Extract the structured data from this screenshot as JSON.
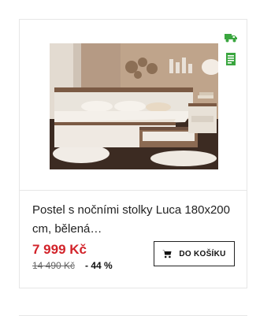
{
  "product": {
    "name": "Postel s nočními stolky Luca 180x200 cm, bělená…",
    "price": "7 999 Kč",
    "old_price": "14 490 Kč",
    "discount": "- 44 %",
    "cart_button_label": "DO KOŠÍKU",
    "badges": [
      "truck-icon",
      "document-icon"
    ],
    "accent_color": "#d2232a",
    "badge_color": "#3aa63f"
  }
}
